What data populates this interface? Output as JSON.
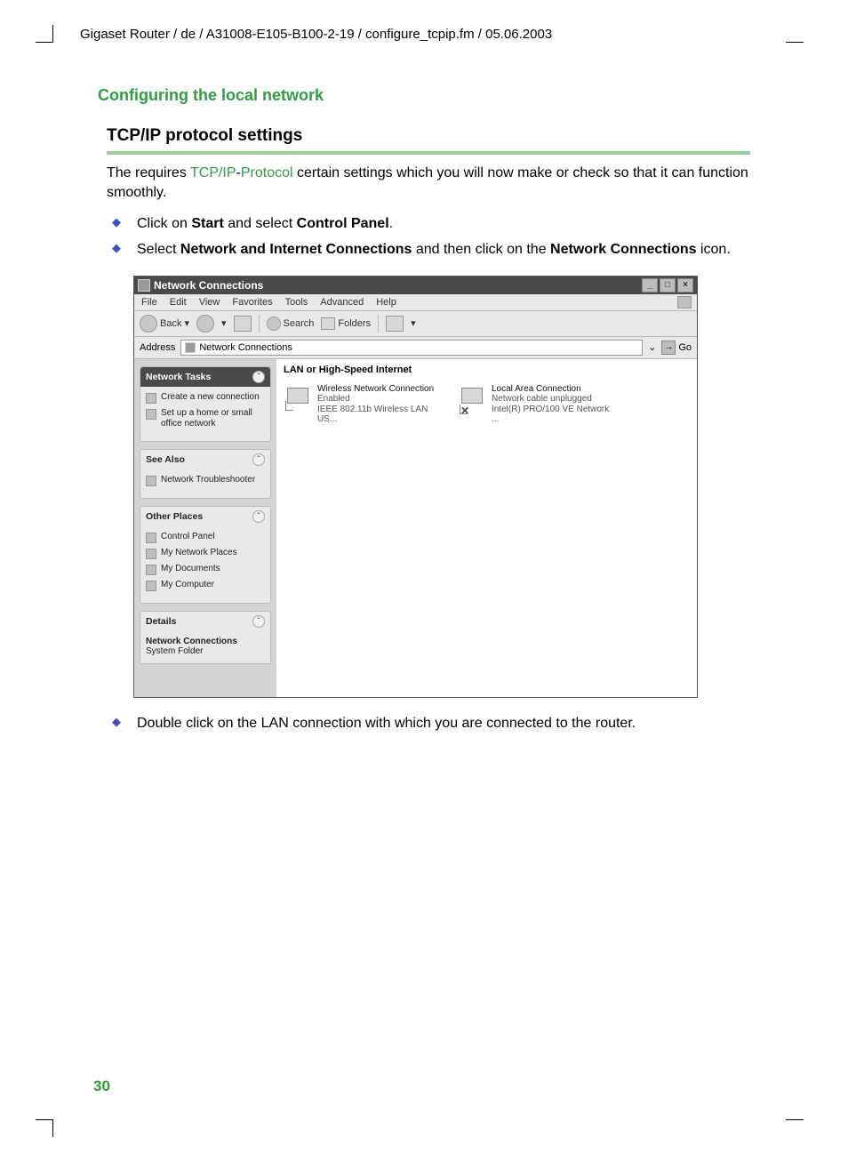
{
  "header_path": "Gigaset Router / de / A31008-E105-B100-2-19 / configure_tcpip.fm / 05.06.2003",
  "section_title": "Configuring the local network",
  "sub_title": "TCP/IP protocol settings",
  "intro_pre": "The requires ",
  "intro_link1": "TCP/IP",
  "intro_dash": "-",
  "intro_link2": "Protocol",
  "intro_post": " certain settings which you will now make or check so that it can function smoothly.",
  "bullet1_a": "Click on ",
  "bullet1_b": "Start",
  "bullet1_c": " and select ",
  "bullet1_d": "Control Panel",
  "bullet1_e": ".",
  "bullet2_a": "Select ",
  "bullet2_b": "Network and Internet Connections",
  "bullet2_c": " and then click on the ",
  "bullet2_d": "Network Connections",
  "bullet2_e": " icon.",
  "bullet3": "Double click on the LAN connection with which you are connected to the router.",
  "page_num": "30",
  "win": {
    "title": "Network Connections",
    "menus": [
      "File",
      "Edit",
      "View",
      "Favorites",
      "Tools",
      "Advanced",
      "Help"
    ],
    "toolbar": {
      "back": "Back",
      "search": "Search",
      "folders": "Folders"
    },
    "addr_label": "Address",
    "addr_value": "Network Connections",
    "go": "Go",
    "tb_min": "_",
    "tb_max": "□",
    "tb_close": "×",
    "left": {
      "p1_title": "Network Tasks",
      "p1_items": [
        "Create a new connection",
        "Set up a home or small office network"
      ],
      "p2_title": "See Also",
      "p2_items": [
        "Network Troubleshooter"
      ],
      "p3_title": "Other Places",
      "p3_items": [
        "Control Panel",
        "My Network Places",
        "My Documents",
        "My Computer"
      ],
      "p4_title": "Details",
      "p4_line1": "Network Connections",
      "p4_line2": "System Folder"
    },
    "right": {
      "cat": "LAN or High-Speed Internet",
      "conn1": {
        "t1": "Wireless Network Connection",
        "t2": "Enabled",
        "t3": "IEEE 802.11b Wireless LAN US..."
      },
      "conn2": {
        "t1": "Local Area Connection",
        "t2": "Network cable unplugged",
        "t3": "Intel(R) PRO/100 VE Network ..."
      }
    }
  }
}
